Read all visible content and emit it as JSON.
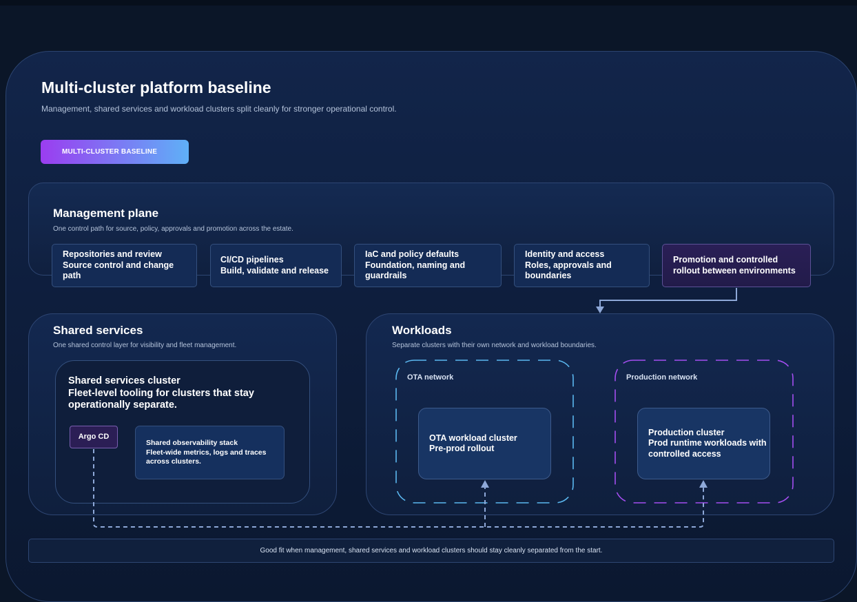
{
  "header": {
    "title": "Multi-cluster platform baseline",
    "subtitle": "Management, shared services and workload clusters split cleanly for stronger operational control.",
    "badge": "MULTI-CLUSTER BASELINE"
  },
  "management": {
    "title": "Management plane",
    "subtitle": "One control path for source, policy, approvals and promotion across the estate.",
    "cards": [
      {
        "line1": "Repositories and review",
        "line2": "Source control and change path"
      },
      {
        "line1": "CI/CD pipelines",
        "line2": "Build, validate and release"
      },
      {
        "line1": "IaC and policy defaults",
        "line2": "Foundation, naming and guardrails"
      },
      {
        "line1": "Identity and access",
        "line2": "Roles, approvals and boundaries"
      },
      {
        "line1": "Promotion and controlled rollout between environments",
        "line2": ""
      }
    ]
  },
  "shared": {
    "title": "Shared services",
    "subtitle": "One shared control layer for visibility and fleet management.",
    "cluster": {
      "line1": "Shared services cluster",
      "line2": "Fleet-level tooling for clusters that stay operationally separate."
    },
    "argo": "Argo CD",
    "observability": {
      "line1": "Shared observability stack",
      "line2": "Fleet-wide metrics, logs and traces across clusters."
    }
  },
  "workloads": {
    "title": "Workloads",
    "subtitle": "Separate clusters with their own network and workload boundaries.",
    "ota": {
      "network": "OTA network",
      "line1": "OTA workload cluster",
      "line2": "Pre-prod rollout"
    },
    "prod": {
      "network": "Production network",
      "line1": "Production cluster",
      "line2": "Prod runtime workloads with controlled access"
    }
  },
  "footer": "Good fit when management, shared services and workload clusters should stay cleanly separated from the start.",
  "colors": {
    "background": "#0b1628",
    "badge_start": "#9b3df0",
    "badge_end": "#5fb0f7",
    "ota_network_border": "#5bb8f0",
    "prod_network_border": "#a44ef0",
    "connector": "#8ea8d8"
  }
}
